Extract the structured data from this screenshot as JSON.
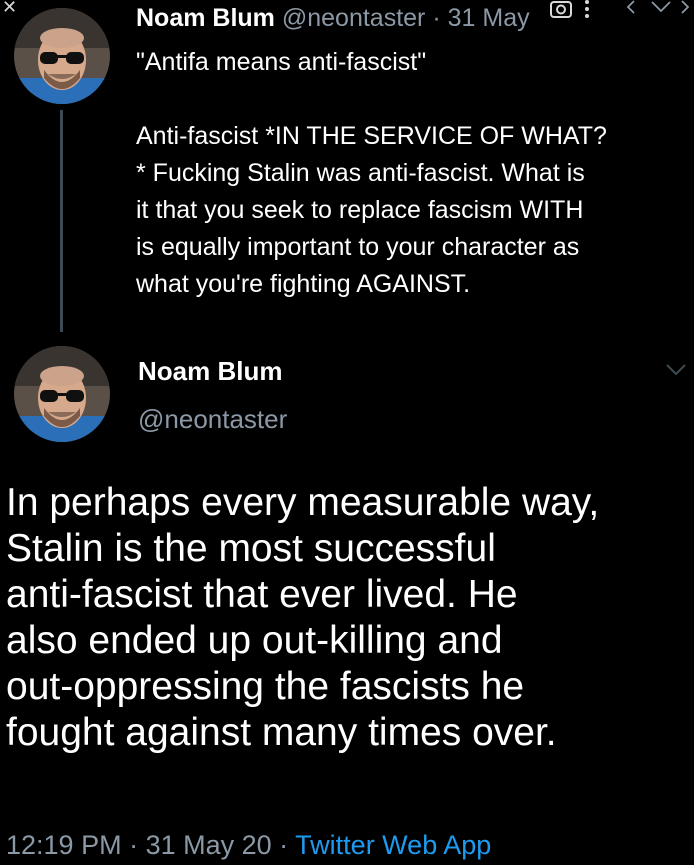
{
  "tweet1": {
    "name": "Noam Blum",
    "handle": "@neontaster",
    "separator": " · ",
    "date": "31 May",
    "body_lines": [
      "\"Antifa means anti-fascist\"",
      "",
      "Anti-fascist *IN THE SERVICE OF WHAT?",
      "* Fucking Stalin was anti-fascist. What is",
      "it that you seek to replace fascism WITH",
      "is equally important to your character as",
      "what you're fighting AGAINST."
    ]
  },
  "tweet2": {
    "name": "Noam Blum",
    "handle": "@neontaster",
    "body_lines": [
      "In perhaps every measurable way,",
      "Stalin is the most successful",
      "anti-fascist that ever lived. He",
      "also ended up out-killing and",
      "out-oppressing the fascists he",
      "fought against many times over."
    ],
    "time": "12:19 PM",
    "separator": " · ",
    "date": "31 May 20",
    "source": "Twitter Web App"
  },
  "icons": {
    "close": "close-icon",
    "camera": "camera-icon",
    "more": "more-icon",
    "chevron": "chevron-down-icon",
    "prev": "chevron-left-icon",
    "next": "chevron-right-icon"
  },
  "colors": {
    "background": "#000000",
    "text": "#ffffff",
    "secondary": "#8b98a5",
    "link": "#1d9bf0",
    "thread_line": "#3d4a54"
  }
}
